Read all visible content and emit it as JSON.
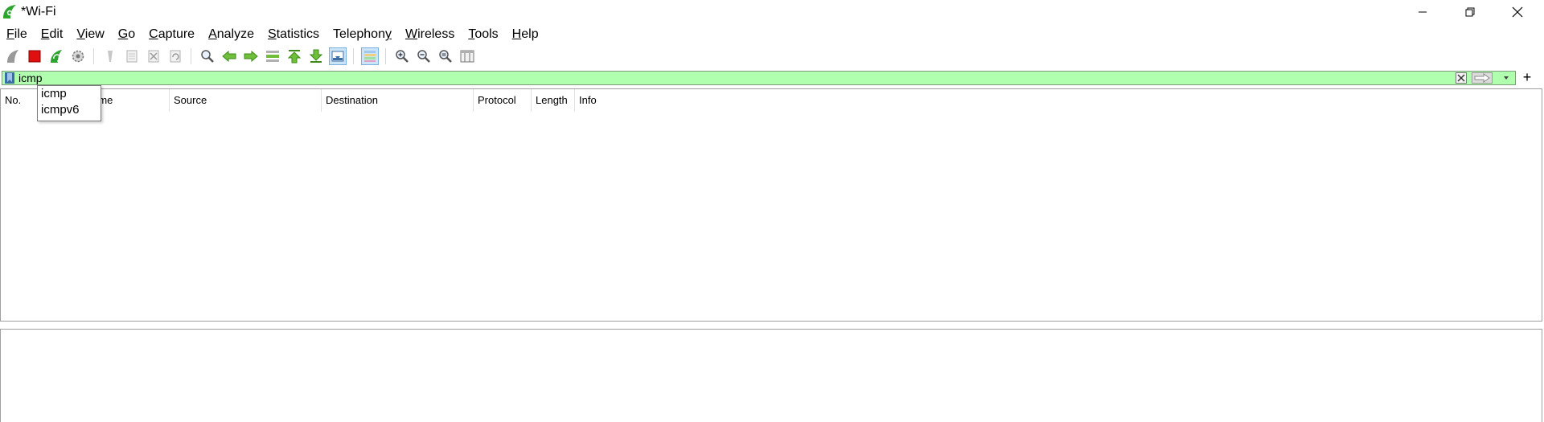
{
  "window": {
    "title": "*Wi-Fi",
    "controls": [
      "minimize",
      "restore",
      "close"
    ]
  },
  "menu": {
    "items": [
      {
        "mnemonic": "F",
        "rest": "ile"
      },
      {
        "mnemonic": "E",
        "rest": "dit"
      },
      {
        "mnemonic": "V",
        "rest": "iew"
      },
      {
        "mnemonic": "G",
        "rest": "o"
      },
      {
        "mnemonic": "C",
        "rest": "apture"
      },
      {
        "mnemonic": "A",
        "rest": "nalyze"
      },
      {
        "mnemonic": "S",
        "rest": "tatistics"
      },
      {
        "mnemonic": "",
        "rest": "Telephon",
        "trailing_mnemonic": "y"
      },
      {
        "mnemonic": "W",
        "rest": "ireless"
      },
      {
        "mnemonic": "T",
        "rest": "ools"
      },
      {
        "mnemonic": "H",
        "rest": "elp"
      }
    ]
  },
  "toolbar": {
    "icons": [
      "shark-fin-start-icon",
      "stop-capture-icon",
      "restart-capture-icon",
      "capture-options-icon",
      "open-file-icon",
      "save-file-icon",
      "close-file-icon",
      "reload-file-icon",
      "find-packet-icon",
      "go-back-icon",
      "go-forward-icon",
      "go-to-packet-icon",
      "go-first-icon",
      "go-last-icon",
      "autoscroll-icon",
      "colorize-icon",
      "zoom-in-icon",
      "zoom-out-icon",
      "zoom-normal-icon",
      "resize-columns-icon"
    ]
  },
  "filter": {
    "value": "icmp",
    "background_color": "#afffaf",
    "add_label": "+"
  },
  "autocomplete": {
    "items": [
      "icmp",
      "icmpv6"
    ]
  },
  "packet_list": {
    "columns": [
      "No.",
      "Time",
      "Source",
      "Destination",
      "Protocol",
      "Length",
      "Info"
    ],
    "rows": []
  },
  "colors": {
    "accent_green": "#2ea32e",
    "stop_red": "#e01010"
  }
}
